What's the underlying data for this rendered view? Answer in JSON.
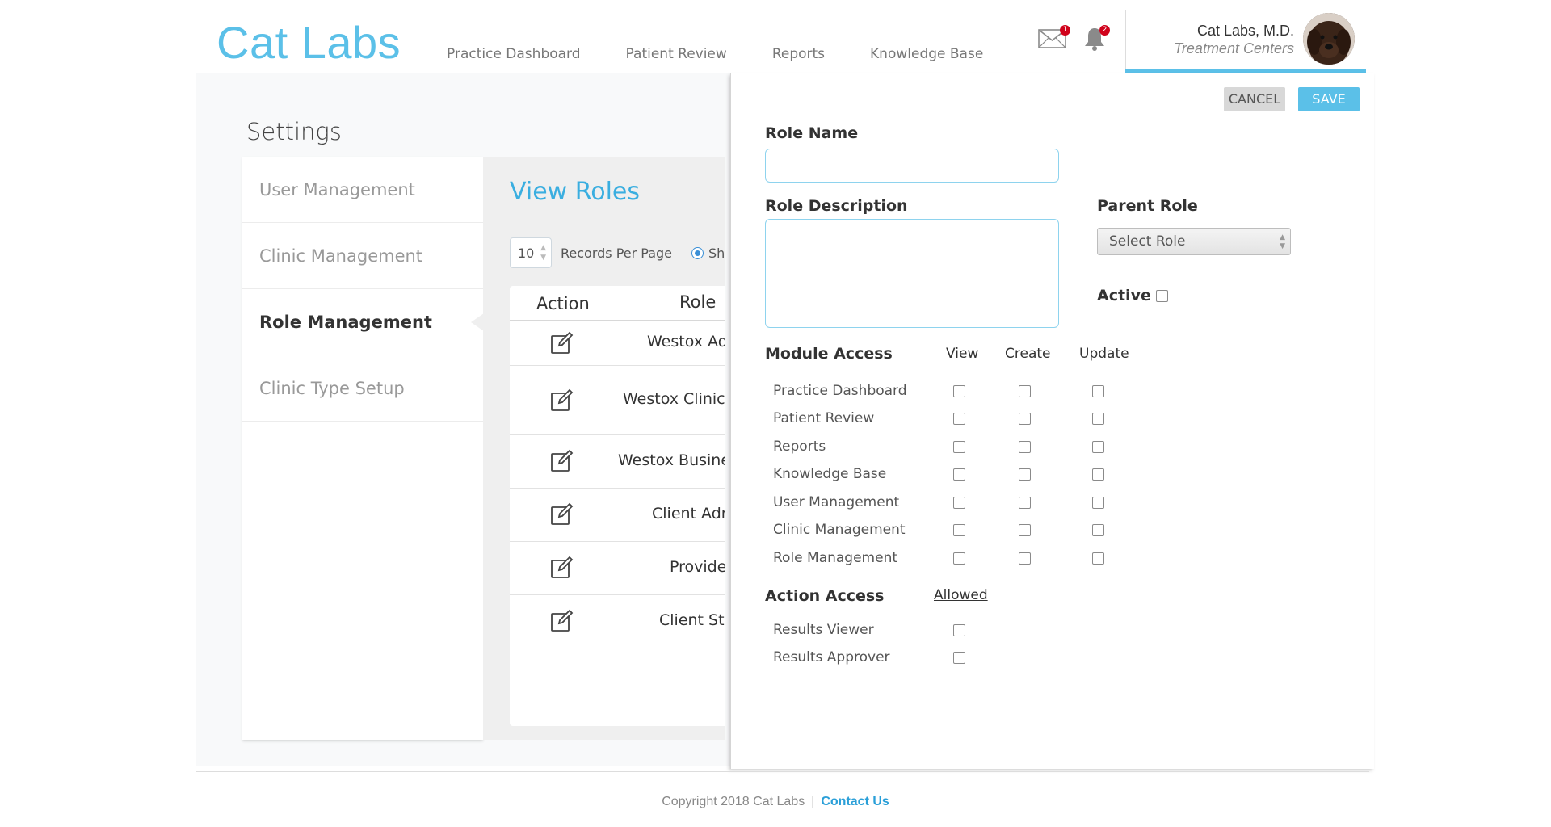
{
  "app": {
    "logo": "Cat Labs"
  },
  "nav": {
    "items": [
      "Practice Dashboard",
      "Patient Review",
      "Reports",
      "Knowledge Base"
    ]
  },
  "notifications": {
    "mail_count": "1",
    "bell_count": "2"
  },
  "user": {
    "name": "Cat Labs, M.D.",
    "subtitle": "Treatment Centers"
  },
  "settings": {
    "title": "Settings",
    "sidebar": [
      "User Management",
      "Clinic Management",
      "Role Management",
      "Clinic Type Setup"
    ],
    "active_item": "Role Management"
  },
  "roles": {
    "title": "View Roles",
    "per_page_value": "10",
    "per_page_label": "Records Per Page",
    "radio_label": "Sho",
    "columns": [
      "Action",
      "Role"
    ],
    "rows": [
      "Westox Ad",
      "Westox Clinic",
      "Westox Busine",
      "Client Adr",
      "Provide",
      "Client St"
    ]
  },
  "panel": {
    "cancel": "CANCEL",
    "save": "SAVE",
    "role_name_label": "Role Name",
    "role_description_label": "Role Description",
    "parent_role_label": "Parent Role",
    "parent_role_value": "Select Role",
    "active_label": "Active",
    "module_access_label": "Module Access",
    "module_columns": [
      "View",
      "Create",
      "Update"
    ],
    "modules": [
      "Practice Dashboard",
      "Patient Review",
      "Reports",
      "Knowledge Base",
      "User Management",
      "Clinic Management",
      "Role Management"
    ],
    "action_access_label": "Action Access",
    "action_columns": [
      "Allowed"
    ],
    "actions": [
      "Results Viewer",
      "Results Approver"
    ]
  },
  "footer": {
    "copyright": "Copyright 2018 Cat Labs",
    "separator": "|",
    "contact": "Contact Us"
  },
  "colors": {
    "accent": "#5bc0e8",
    "link": "#2a9fd8",
    "badge": "#d0021b"
  }
}
